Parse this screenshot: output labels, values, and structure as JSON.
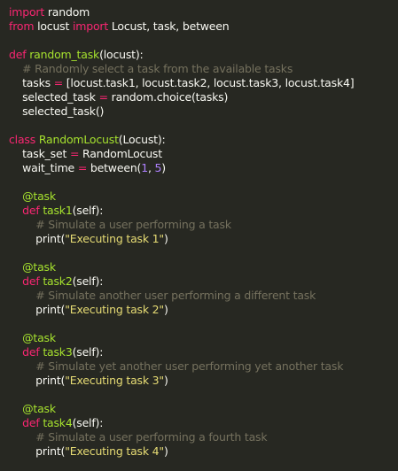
{
  "colors": {
    "background": "#272822",
    "default_text": "#f8f8f2",
    "keyword": "#f92672",
    "function_name": "#a6e22e",
    "number": "#ae81ff",
    "string": "#e6db74",
    "comment": "#75715e"
  },
  "lines": [
    [
      {
        "t": "kw",
        "v": "import"
      },
      {
        "t": "plain",
        "v": " random"
      }
    ],
    [
      {
        "t": "kw",
        "v": "from"
      },
      {
        "t": "plain",
        "v": " locust "
      },
      {
        "t": "kw",
        "v": "import"
      },
      {
        "t": "plain",
        "v": " Locust, task, between"
      }
    ],
    [],
    [
      {
        "t": "kw",
        "v": "def"
      },
      {
        "t": "plain",
        "v": " "
      },
      {
        "t": "fn",
        "v": "random_task"
      },
      {
        "t": "plain",
        "v": "(locust):"
      }
    ],
    [
      {
        "t": "plain",
        "v": "    "
      },
      {
        "t": "cm",
        "v": "# Randomly select a task from the available tasks"
      }
    ],
    [
      {
        "t": "plain",
        "v": "    tasks "
      },
      {
        "t": "kw",
        "v": "="
      },
      {
        "t": "plain",
        "v": " [locust.task1, locust.task2, locust.task3, locust.task4]"
      }
    ],
    [
      {
        "t": "plain",
        "v": "    selected_task "
      },
      {
        "t": "kw",
        "v": "="
      },
      {
        "t": "plain",
        "v": " random.choice(tasks)"
      }
    ],
    [
      {
        "t": "plain",
        "v": "    selected_task()"
      }
    ],
    [],
    [
      {
        "t": "kw",
        "v": "class"
      },
      {
        "t": "plain",
        "v": " "
      },
      {
        "t": "fn",
        "v": "RandomLocust"
      },
      {
        "t": "plain",
        "v": "(Locust):"
      }
    ],
    [
      {
        "t": "plain",
        "v": "    task_set "
      },
      {
        "t": "kw",
        "v": "="
      },
      {
        "t": "plain",
        "v": " RandomLocust"
      }
    ],
    [
      {
        "t": "plain",
        "v": "    wait_time "
      },
      {
        "t": "kw",
        "v": "="
      },
      {
        "t": "plain",
        "v": " between("
      },
      {
        "t": "num",
        "v": "1"
      },
      {
        "t": "plain",
        "v": ", "
      },
      {
        "t": "num",
        "v": "5"
      },
      {
        "t": "plain",
        "v": ")"
      }
    ],
    [],
    [
      {
        "t": "plain",
        "v": "    "
      },
      {
        "t": "dec",
        "v": "@task"
      }
    ],
    [
      {
        "t": "plain",
        "v": "    "
      },
      {
        "t": "kw",
        "v": "def"
      },
      {
        "t": "plain",
        "v": " "
      },
      {
        "t": "fn",
        "v": "task1"
      },
      {
        "t": "plain",
        "v": "(self):"
      }
    ],
    [
      {
        "t": "plain",
        "v": "        "
      },
      {
        "t": "cm",
        "v": "# Simulate a user performing a task"
      }
    ],
    [
      {
        "t": "plain",
        "v": "        print("
      },
      {
        "t": "str",
        "v": "\"Executing task 1\""
      },
      {
        "t": "plain",
        "v": ")"
      }
    ],
    [],
    [
      {
        "t": "plain",
        "v": "    "
      },
      {
        "t": "dec",
        "v": "@task"
      }
    ],
    [
      {
        "t": "plain",
        "v": "    "
      },
      {
        "t": "kw",
        "v": "def"
      },
      {
        "t": "plain",
        "v": " "
      },
      {
        "t": "fn",
        "v": "task2"
      },
      {
        "t": "plain",
        "v": "(self):"
      }
    ],
    [
      {
        "t": "plain",
        "v": "        "
      },
      {
        "t": "cm",
        "v": "# Simulate another user performing a different task"
      }
    ],
    [
      {
        "t": "plain",
        "v": "        print("
      },
      {
        "t": "str",
        "v": "\"Executing task 2\""
      },
      {
        "t": "plain",
        "v": ")"
      }
    ],
    [],
    [
      {
        "t": "plain",
        "v": "    "
      },
      {
        "t": "dec",
        "v": "@task"
      }
    ],
    [
      {
        "t": "plain",
        "v": "    "
      },
      {
        "t": "kw",
        "v": "def"
      },
      {
        "t": "plain",
        "v": " "
      },
      {
        "t": "fn",
        "v": "task3"
      },
      {
        "t": "plain",
        "v": "(self):"
      }
    ],
    [
      {
        "t": "plain",
        "v": "        "
      },
      {
        "t": "cm",
        "v": "# Simulate yet another user performing yet another task"
      }
    ],
    [
      {
        "t": "plain",
        "v": "        print("
      },
      {
        "t": "str",
        "v": "\"Executing task 3\""
      },
      {
        "t": "plain",
        "v": ")"
      }
    ],
    [],
    [
      {
        "t": "plain",
        "v": "    "
      },
      {
        "t": "dec",
        "v": "@task"
      }
    ],
    [
      {
        "t": "plain",
        "v": "    "
      },
      {
        "t": "kw",
        "v": "def"
      },
      {
        "t": "plain",
        "v": " "
      },
      {
        "t": "fn",
        "v": "task4"
      },
      {
        "t": "plain",
        "v": "(self):"
      }
    ],
    [
      {
        "t": "plain",
        "v": "        "
      },
      {
        "t": "cm",
        "v": "# Simulate a user performing a fourth task"
      }
    ],
    [
      {
        "t": "plain",
        "v": "        print("
      },
      {
        "t": "str",
        "v": "\"Executing task 4\""
      },
      {
        "t": "plain",
        "v": ")"
      }
    ]
  ]
}
